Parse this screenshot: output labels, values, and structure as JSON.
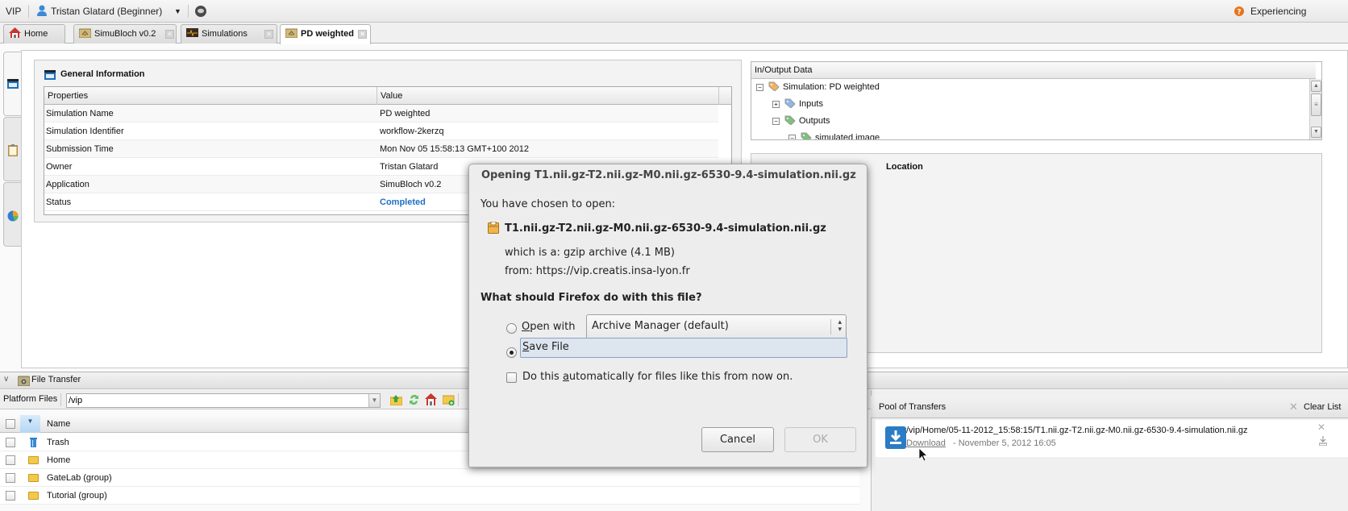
{
  "topbar": {
    "app_name": "VIP",
    "user": "Tristan Glatard (Beginner)",
    "help_link": "Experiencing problems?"
  },
  "tabs": [
    {
      "label": "Home",
      "closable": false,
      "active": false
    },
    {
      "label": "SimuBloch v0.2",
      "closable": true,
      "active": false
    },
    {
      "label": "Simulations",
      "closable": true,
      "active": false
    },
    {
      "label": "PD weighted",
      "closable": true,
      "active": true
    }
  ],
  "general_info": {
    "title": "General Information",
    "columns": [
      "Properties",
      "Value"
    ],
    "rows": [
      {
        "property": "Simulation Name",
        "value": "PD weighted"
      },
      {
        "property": "Simulation Identifier",
        "value": "workflow-2kerzq"
      },
      {
        "property": "Submission Time",
        "value": "Mon Nov 05 15:58:13 GMT+100 2012"
      },
      {
        "property": "Owner",
        "value": "Tristan Glatard"
      },
      {
        "property": "Application",
        "value": "SimuBloch v0.2"
      },
      {
        "property": "Status",
        "value": "Completed"
      }
    ],
    "status_color": "#1f6fc5"
  },
  "io_data": {
    "title": "In/Output Data",
    "tree": [
      {
        "label": "Simulation: PD weighted",
        "level": 0,
        "toggle": "-"
      },
      {
        "label": "Inputs",
        "level": 1,
        "toggle": "+"
      },
      {
        "label": "Outputs",
        "level": 1,
        "toggle": "-"
      },
      {
        "label": "simulated image",
        "level": 2,
        "toggle": "-"
      }
    ]
  },
  "location_panel": {
    "title_partial": "Location"
  },
  "file_transfer": {
    "title": "File Transfer",
    "platform_files_label": "Platform Files",
    "path_value": "/vip",
    "list_header": "Name",
    "files": [
      {
        "name": "Trash",
        "icon": "trash-icon"
      },
      {
        "name": "Home",
        "icon": "folder-icon"
      },
      {
        "name": "GateLab (group)",
        "icon": "folder-icon"
      },
      {
        "name": "Tutorial (group)",
        "icon": "folder-icon"
      }
    ]
  },
  "pool": {
    "title": "Pool of Transfers",
    "clear_label": "Clear List",
    "items": [
      {
        "path": "/vip/Home/05-11-2012_15:58:15/T1.nii.gz-T2.nii.gz-M0.nii.gz-6530-9.4-simulation.nii.gz",
        "action": "Download",
        "date": "- November 5, 2012 16:05"
      }
    ]
  },
  "dialog": {
    "title": "Opening T1.nii.gz-T2.nii.gz-M0.nii.gz-6530-9.4-simulation.nii.gz",
    "chosen_label": "You have chosen to open:",
    "filename": "T1.nii.gz-T2.nii.gz-M0.nii.gz-6530-9.4-simulation.nii.gz",
    "type_line": "which is a:  gzip archive (4.1 MB)",
    "from_line": "from:  https://vip.creatis.insa-lyon.fr",
    "question": "What should Firefox do with this file?",
    "open_with_label": "Open with",
    "open_with_app": "Archive Manager (default)",
    "save_label": "Save File",
    "selected_option": "save",
    "auto_label": "Do this automatically for files like this from now on.",
    "auto_checked": false,
    "cancel_label": "Cancel",
    "ok_label": "OK",
    "ok_enabled": false
  }
}
